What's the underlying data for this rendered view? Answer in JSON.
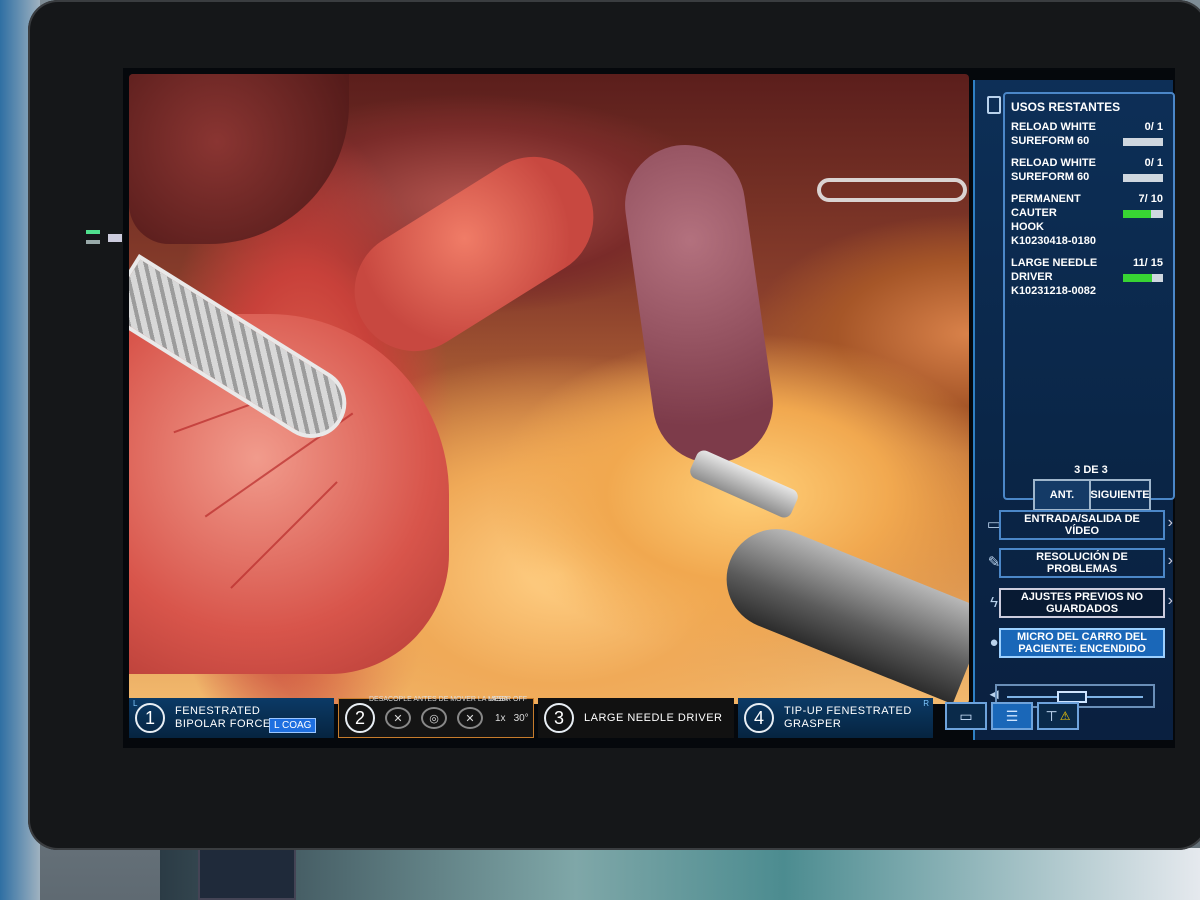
{
  "instrument_bar": {
    "arm1": {
      "number": "1",
      "side": "L",
      "label_line1": "FENESTRATED",
      "label_line2": "BIPOLAR FORCEPS",
      "mode": "L COAG"
    },
    "arm2": {
      "number": "2",
      "warning": "DESACOPLE ANTES DE MOVER LA MESA",
      "laser": "LASER OFF",
      "zoom": "1x",
      "angle": "30°"
    },
    "arm3": {
      "number": "3",
      "label": "LARGE NEEDLE DRIVER"
    },
    "arm4": {
      "number": "4",
      "side": "R",
      "label_line1": "TIP-UP FENESTRATED",
      "label_line2": "GRASPER"
    }
  },
  "panel": {
    "uses_title": "USOS RESTANTES",
    "uses": [
      {
        "name_line1": "RELOAD WHITE",
        "name_line2": "SUREFORM 60",
        "count": "0/ 1",
        "remaining_fraction": 0.0,
        "code": ""
      },
      {
        "name_line1": "RELOAD WHITE",
        "name_line2": "SUREFORM 60",
        "count": "0/ 1",
        "remaining_fraction": 0.0,
        "code": ""
      },
      {
        "name_line1": "PERMANENT CAUTER",
        "name_line2": "HOOK",
        "count": "7/ 10",
        "remaining_fraction": 0.7,
        "code": "K10230418-0180"
      },
      {
        "name_line1": "LARGE NEEDLE",
        "name_line2": "DRIVER",
        "count": "11/ 15",
        "remaining_fraction": 0.73,
        "code": "K10231218-0082"
      }
    ],
    "page_indicator": "3 DE 3",
    "prev_label": "ANT.",
    "next_label": "SIGUIENTE",
    "menu": {
      "video_io": "ENTRADA/SALIDA DE VÍDEO",
      "troubleshooting": "RESOLUCIÓN DE PROBLEMAS",
      "presets": "AJUSTES PREVIOS NO GUARDADOS",
      "mic": "MICRO DEL CARRO DEL PACIENTE: ENCENDIDO"
    },
    "volume_level": 0.45
  },
  "colors": {
    "panel_bg": "#0d2f57",
    "accent": "#1a67b8",
    "progress_green": "#38d433",
    "warning": "#ffcc00"
  },
  "icons": {
    "video": "video-3d-icon",
    "troubleshoot": "wrench-icon",
    "presets": "lightning-icon",
    "mic": "microphone-icon",
    "volume": "speaker-icon"
  }
}
